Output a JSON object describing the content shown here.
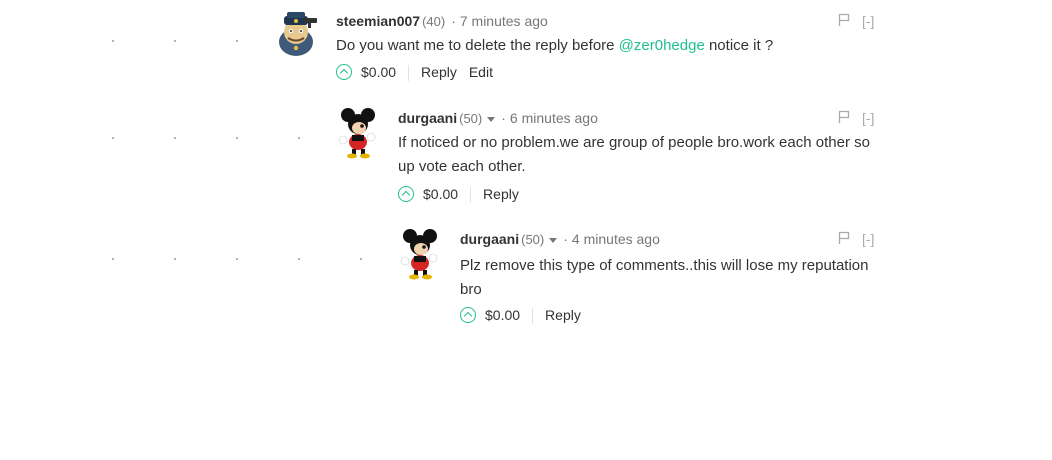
{
  "comments": [
    {
      "author": "steemian007",
      "reputation": "(40)",
      "time": "7 minutes ago",
      "collapse_label": "[-]",
      "text_before": "Do you want me to delete the reply before ",
      "mention": "@zer0hedge",
      "text_after": " notice it ?",
      "payout": "$0.00",
      "reply_label": "Reply",
      "edit_label": "Edit",
      "avatar_icon": "police-cartoon-avatar"
    },
    {
      "author": "durgaani",
      "reputation": "(50)",
      "time": "6 minutes ago",
      "collapse_label": "[-]",
      "text_line1": "If noticed or no problem.we are group of people bro.work each other so",
      "text_line2": "up vote each other.",
      "payout": "$0.00",
      "reply_label": "Reply",
      "avatar_icon": "mickey-mouse-avatar"
    },
    {
      "author": "durgaani",
      "reputation": "(50)",
      "time": "4 minutes ago",
      "collapse_label": "[-]",
      "text_line1": "Plz remove this type of comments..this will lose my reputation",
      "text_line2": "bro",
      "payout": "$0.00",
      "reply_label": "Reply",
      "avatar_icon": "mickey-mouse-avatar"
    }
  ],
  "colors": {
    "accent": "#1fbf8f",
    "muted": "#777777",
    "text": "#333333"
  }
}
